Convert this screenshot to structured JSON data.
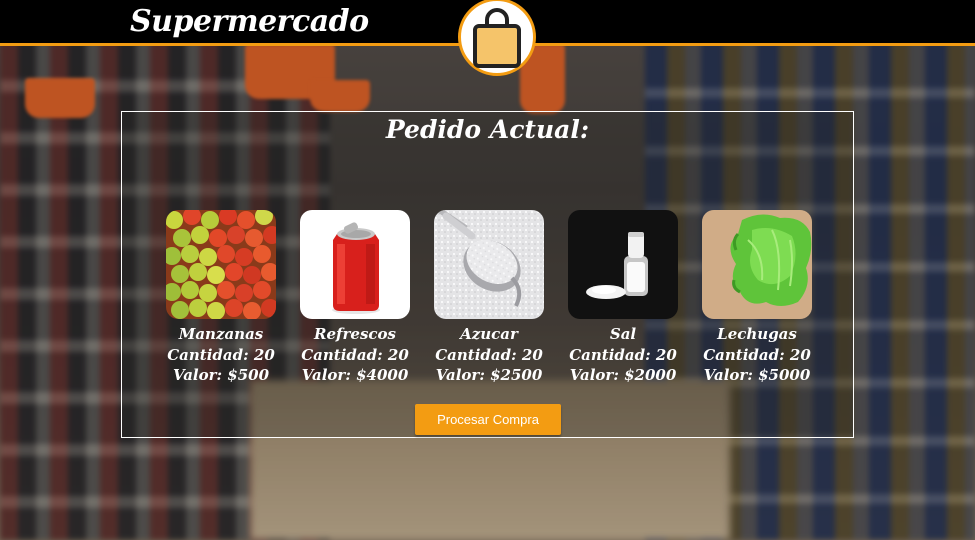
{
  "header": {
    "brand": "Supermercado",
    "cart_icon": "shopping-bag-icon",
    "accent_color": "#f39c12"
  },
  "order": {
    "title": "Pedido Actual:",
    "items": [
      {
        "name": "Manzanas",
        "quantity": "Cantidad: 20",
        "value": "Valor: $500",
        "image": "apples"
      },
      {
        "name": "Refrescos",
        "quantity": "Cantidad: 20",
        "value": "Valor: $4000",
        "image": "soda-can"
      },
      {
        "name": "Azucar",
        "quantity": "Cantidad: 20",
        "value": "Valor: $2500",
        "image": "sugar-spoon"
      },
      {
        "name": "Sal",
        "quantity": "Cantidad: 20",
        "value": "Valor: $2000",
        "image": "salt-shaker"
      },
      {
        "name": "Lechugas",
        "quantity": "Cantidad: 20",
        "value": "Valor: $5000",
        "image": "lettuce"
      }
    ],
    "submit_label": "Procesar Compra"
  }
}
